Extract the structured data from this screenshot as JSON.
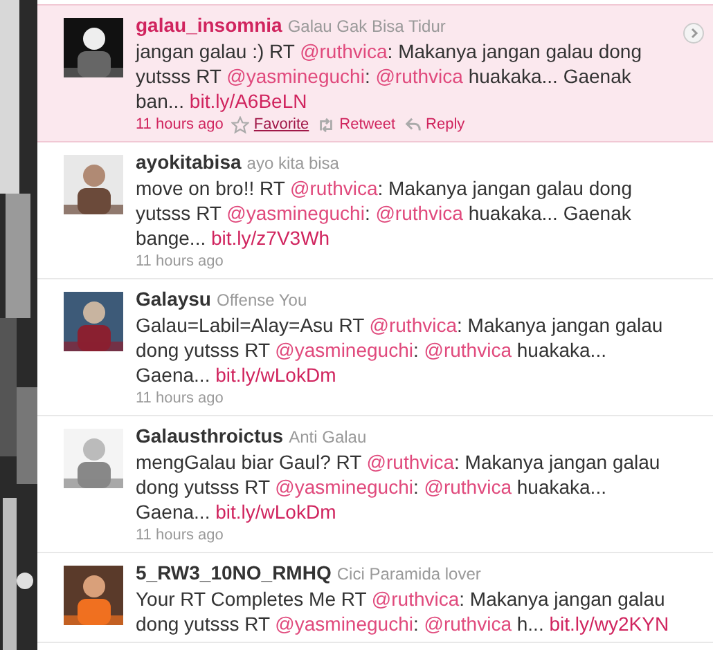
{
  "tweets": [
    {
      "selected": true,
      "username": "galau_insomnia",
      "full_name": "Galau Gak Bisa Tidur",
      "segments": [
        {
          "kind": "text",
          "text": "jangan galau :) RT "
        },
        {
          "kind": "mention",
          "text": "@ruthvica"
        },
        {
          "kind": "text",
          "text": ": Makanya jangan galau dong yutsss RT "
        },
        {
          "kind": "mention",
          "text": "@yasmineguchi"
        },
        {
          "kind": "text",
          "text": ": "
        },
        {
          "kind": "mention",
          "text": "@ruthvica"
        },
        {
          "kind": "text",
          "text": " huakaka... Gaenak ban... "
        },
        {
          "kind": "link",
          "text": "bit.ly/A6BeLN"
        }
      ],
      "time": "11 hours ago",
      "actions": [
        {
          "kind": "favorite",
          "label": "Favorite",
          "hovered": true
        },
        {
          "kind": "retweet",
          "label": "Retweet",
          "hovered": false
        },
        {
          "kind": "reply",
          "label": "Reply",
          "hovered": false
        }
      ]
    },
    {
      "selected": false,
      "username": "ayokitabisa",
      "full_name": "ayo kita bisa",
      "segments": [
        {
          "kind": "text",
          "text": "move on bro!! RT "
        },
        {
          "kind": "mention",
          "text": "@ruthvica"
        },
        {
          "kind": "text",
          "text": ": Makanya jangan galau dong yutsss RT "
        },
        {
          "kind": "mention",
          "text": "@yasmineguchi"
        },
        {
          "kind": "text",
          "text": ": "
        },
        {
          "kind": "mention",
          "text": "@ruthvica"
        },
        {
          "kind": "text",
          "text": " huakaka... Gaenak bange... "
        },
        {
          "kind": "link",
          "text": "bit.ly/z7V3Wh"
        }
      ],
      "time": "11 hours ago"
    },
    {
      "selected": false,
      "username": "Galaysu",
      "full_name": "Offense You",
      "segments": [
        {
          "kind": "text",
          "text": "Galau=Labil=Alay=Asu RT "
        },
        {
          "kind": "mention",
          "text": "@ruthvica"
        },
        {
          "kind": "text",
          "text": ": Makanya jangan galau dong yutsss RT "
        },
        {
          "kind": "mention",
          "text": "@yasmineguchi"
        },
        {
          "kind": "text",
          "text": ": "
        },
        {
          "kind": "mention",
          "text": "@ruthvica"
        },
        {
          "kind": "text",
          "text": " huakaka... Gaena... "
        },
        {
          "kind": "link",
          "text": "bit.ly/wLokDm"
        }
      ],
      "time": "11 hours ago"
    },
    {
      "selected": false,
      "username": "Galausthroictus",
      "full_name": "Anti Galau",
      "segments": [
        {
          "kind": "text",
          "text": "mengGalau biar Gaul? RT "
        },
        {
          "kind": "mention",
          "text": "@ruthvica"
        },
        {
          "kind": "text",
          "text": ": Makanya jangan galau dong yutsss RT "
        },
        {
          "kind": "mention",
          "text": "@yasmineguchi"
        },
        {
          "kind": "text",
          "text": ": "
        },
        {
          "kind": "mention",
          "text": "@ruthvica"
        },
        {
          "kind": "text",
          "text": " huakaka... Gaena... "
        },
        {
          "kind": "link",
          "text": "bit.ly/wLokDm"
        }
      ],
      "time": "11 hours ago"
    },
    {
      "selected": false,
      "username": "5_RW3_10NO_RMHQ",
      "full_name": "Cici Paramida lover",
      "segments": [
        {
          "kind": "text",
          "text": "Your RT Completes Me RT "
        },
        {
          "kind": "mention",
          "text": "@ruthvica"
        },
        {
          "kind": "text",
          "text": ": Makanya jangan galau dong yutsss RT "
        },
        {
          "kind": "mention",
          "text": "@yasmineguchi"
        },
        {
          "kind": "text",
          "text": ": "
        },
        {
          "kind": "mention",
          "text": "@ruthvica"
        },
        {
          "kind": "text",
          "text": " h... "
        },
        {
          "kind": "link",
          "text": "bit.ly/wy2KYN"
        }
      ]
    }
  ]
}
